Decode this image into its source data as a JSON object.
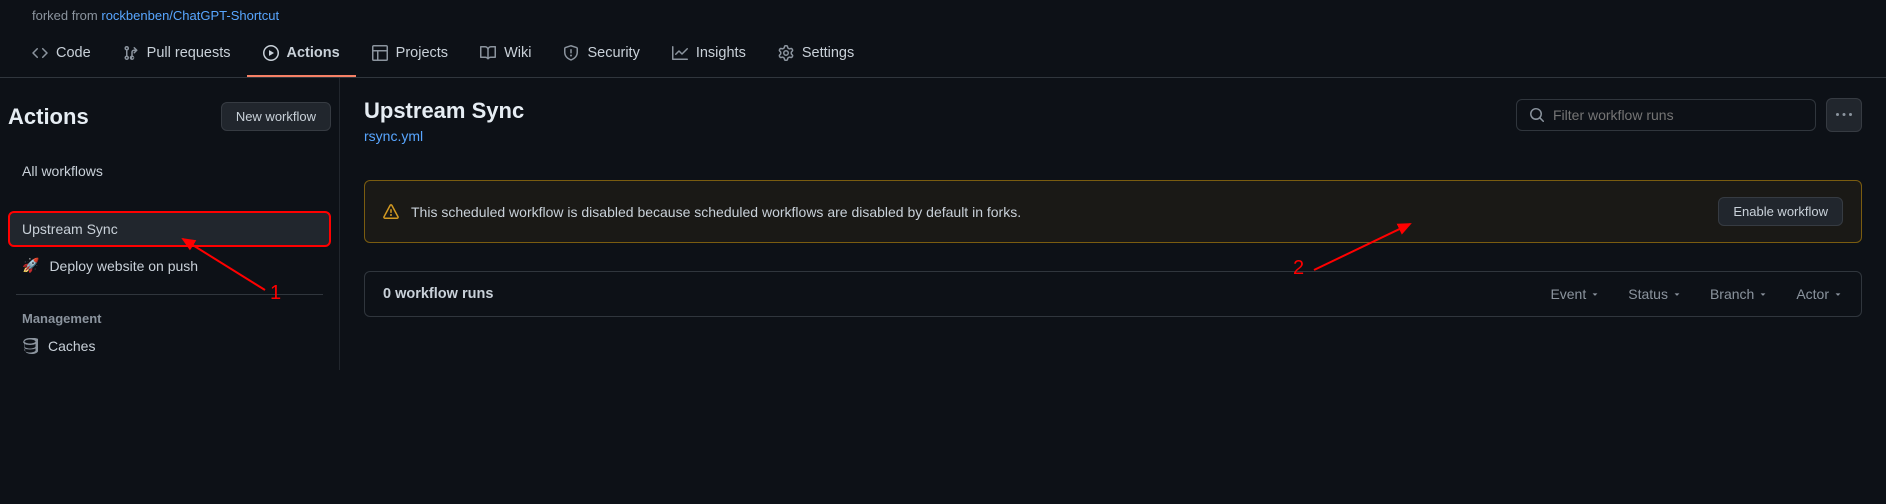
{
  "forked": {
    "prefix": "forked from ",
    "repo": "rockbenben/ChatGPT-Shortcut"
  },
  "nav": {
    "code": "Code",
    "pull_requests": "Pull requests",
    "actions": "Actions",
    "projects": "Projects",
    "wiki": "Wiki",
    "security": "Security",
    "insights": "Insights",
    "settings": "Settings"
  },
  "sidebar": {
    "title": "Actions",
    "new_workflow": "New workflow",
    "all_workflows": "All workflows",
    "upstream_sync": "Upstream Sync",
    "deploy": "Deploy website on push",
    "management": "Management",
    "caches": "Caches"
  },
  "workflow": {
    "title": "Upstream Sync",
    "file": "rsync.yml",
    "search_placeholder": "Filter workflow runs",
    "alert": "This scheduled workflow is disabled because scheduled workflows are disabled by default in forks.",
    "enable_btn": "Enable workflow",
    "runs_count": "0 workflow runs"
  },
  "filters": {
    "event": "Event",
    "status": "Status",
    "branch": "Branch",
    "actor": "Actor"
  },
  "annotations": {
    "one": "1",
    "two": "2"
  }
}
